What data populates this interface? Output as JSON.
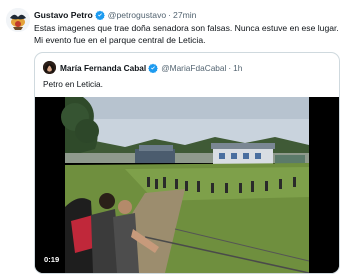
{
  "tweet": {
    "author_name": "Gustavo Petro",
    "handle": "@petrogustavo",
    "separator": "·",
    "time": "27min",
    "text": "Estas imagenes que trae doña senadora son falsas. Nunca estuve en ese lugar. Mi evento fue en el parque central de Leticia."
  },
  "quoted": {
    "author_name": "María Fernanda Cabal",
    "handle": "@MariaFdaCabal",
    "separator": "·",
    "time": "1h",
    "text": "Petro en Leticia.",
    "video": {
      "timestamp": "0:19"
    }
  },
  "colors": {
    "verified": "#1d9bf0",
    "text": "#0f1419",
    "muted": "#536471",
    "border": "#cfd9de"
  }
}
